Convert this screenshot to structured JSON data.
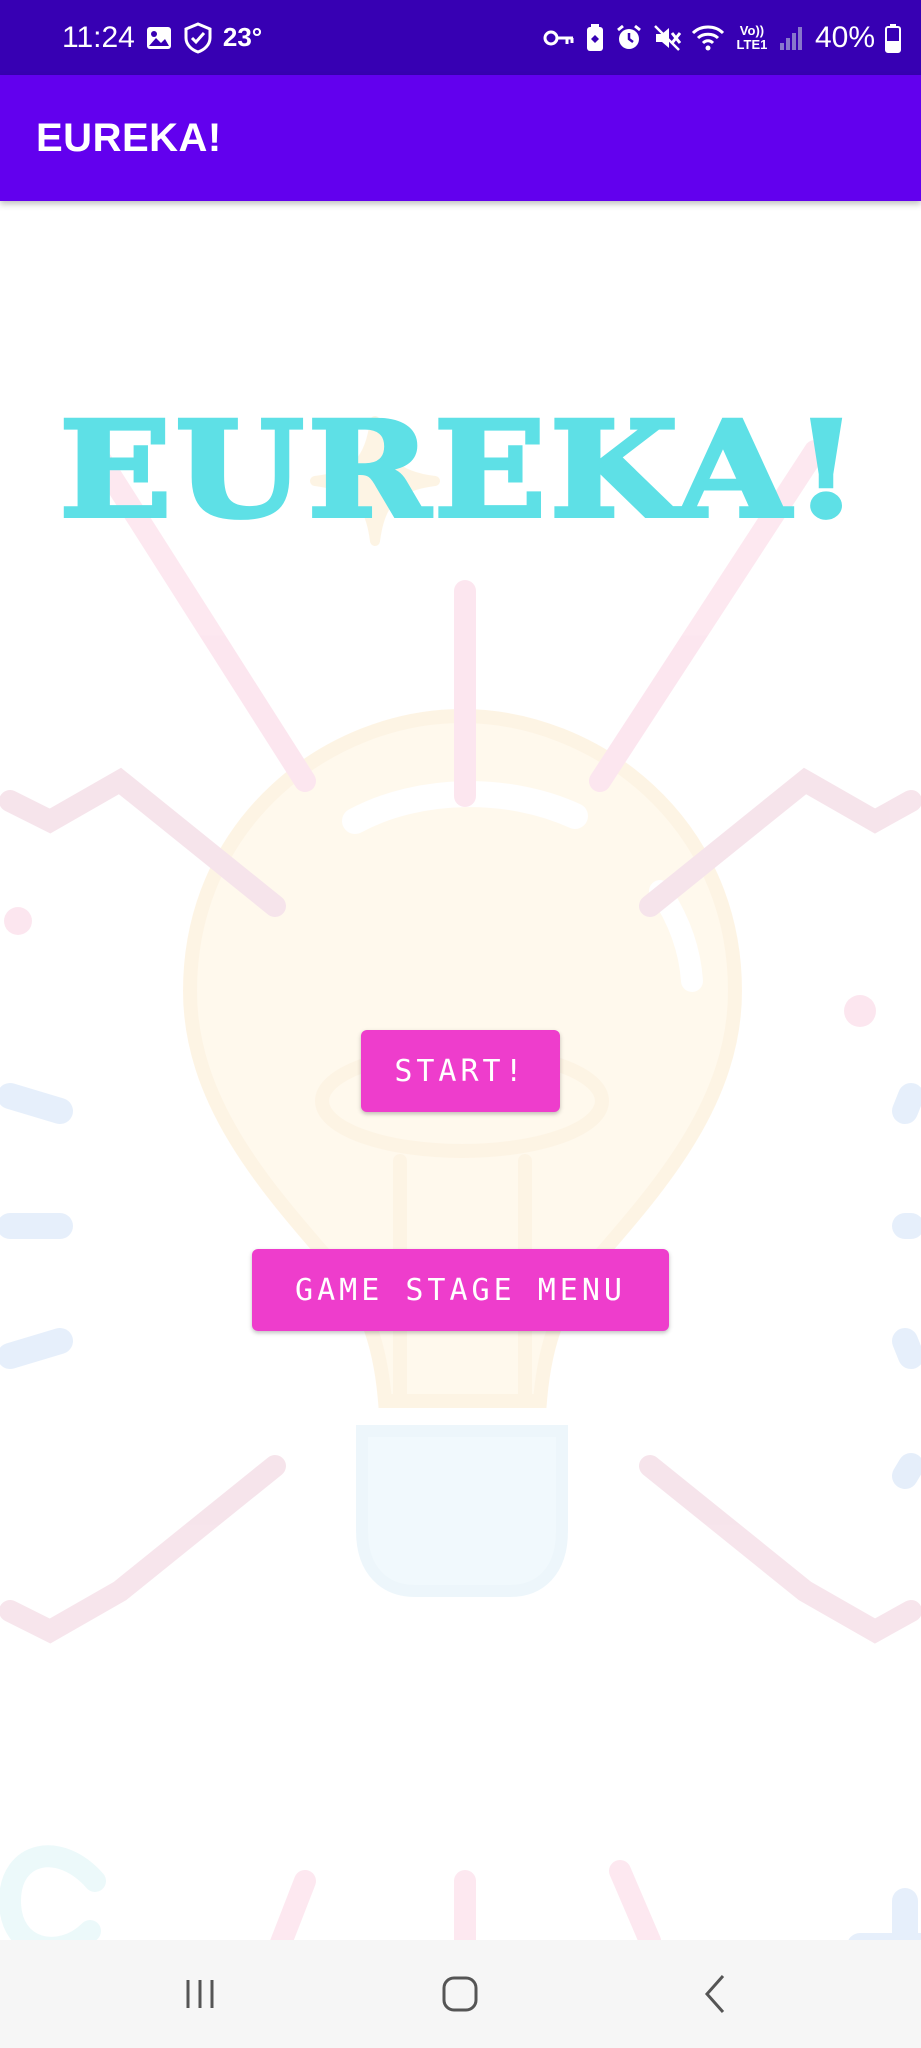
{
  "status_bar": {
    "time": "11:24",
    "temperature": "23°",
    "battery": "40%",
    "icons_left": [
      "gallery-icon",
      "shield-icon"
    ],
    "icons_right": [
      "vpn-key-icon",
      "battery-saver-icon",
      "alarm-icon",
      "mute-icon",
      "wifi-icon",
      "volte-icon",
      "signal-icon",
      "battery-icon"
    ],
    "volte_label": "Vo)) LTE1",
    "background": "#3700b3"
  },
  "app_bar": {
    "title": "EUREKA!",
    "background": "#6200ee"
  },
  "main": {
    "game_title": "EUREKA!",
    "title_color": "#5ee0e6",
    "start_button_label": "START!",
    "menu_button_label": "GAME STAGE MENU",
    "button_color": "#ee3dcc",
    "background_art": "lightbulb-illustration"
  },
  "nav_bar": {
    "buttons": [
      "recent-apps-icon",
      "home-icon",
      "back-icon"
    ]
  }
}
